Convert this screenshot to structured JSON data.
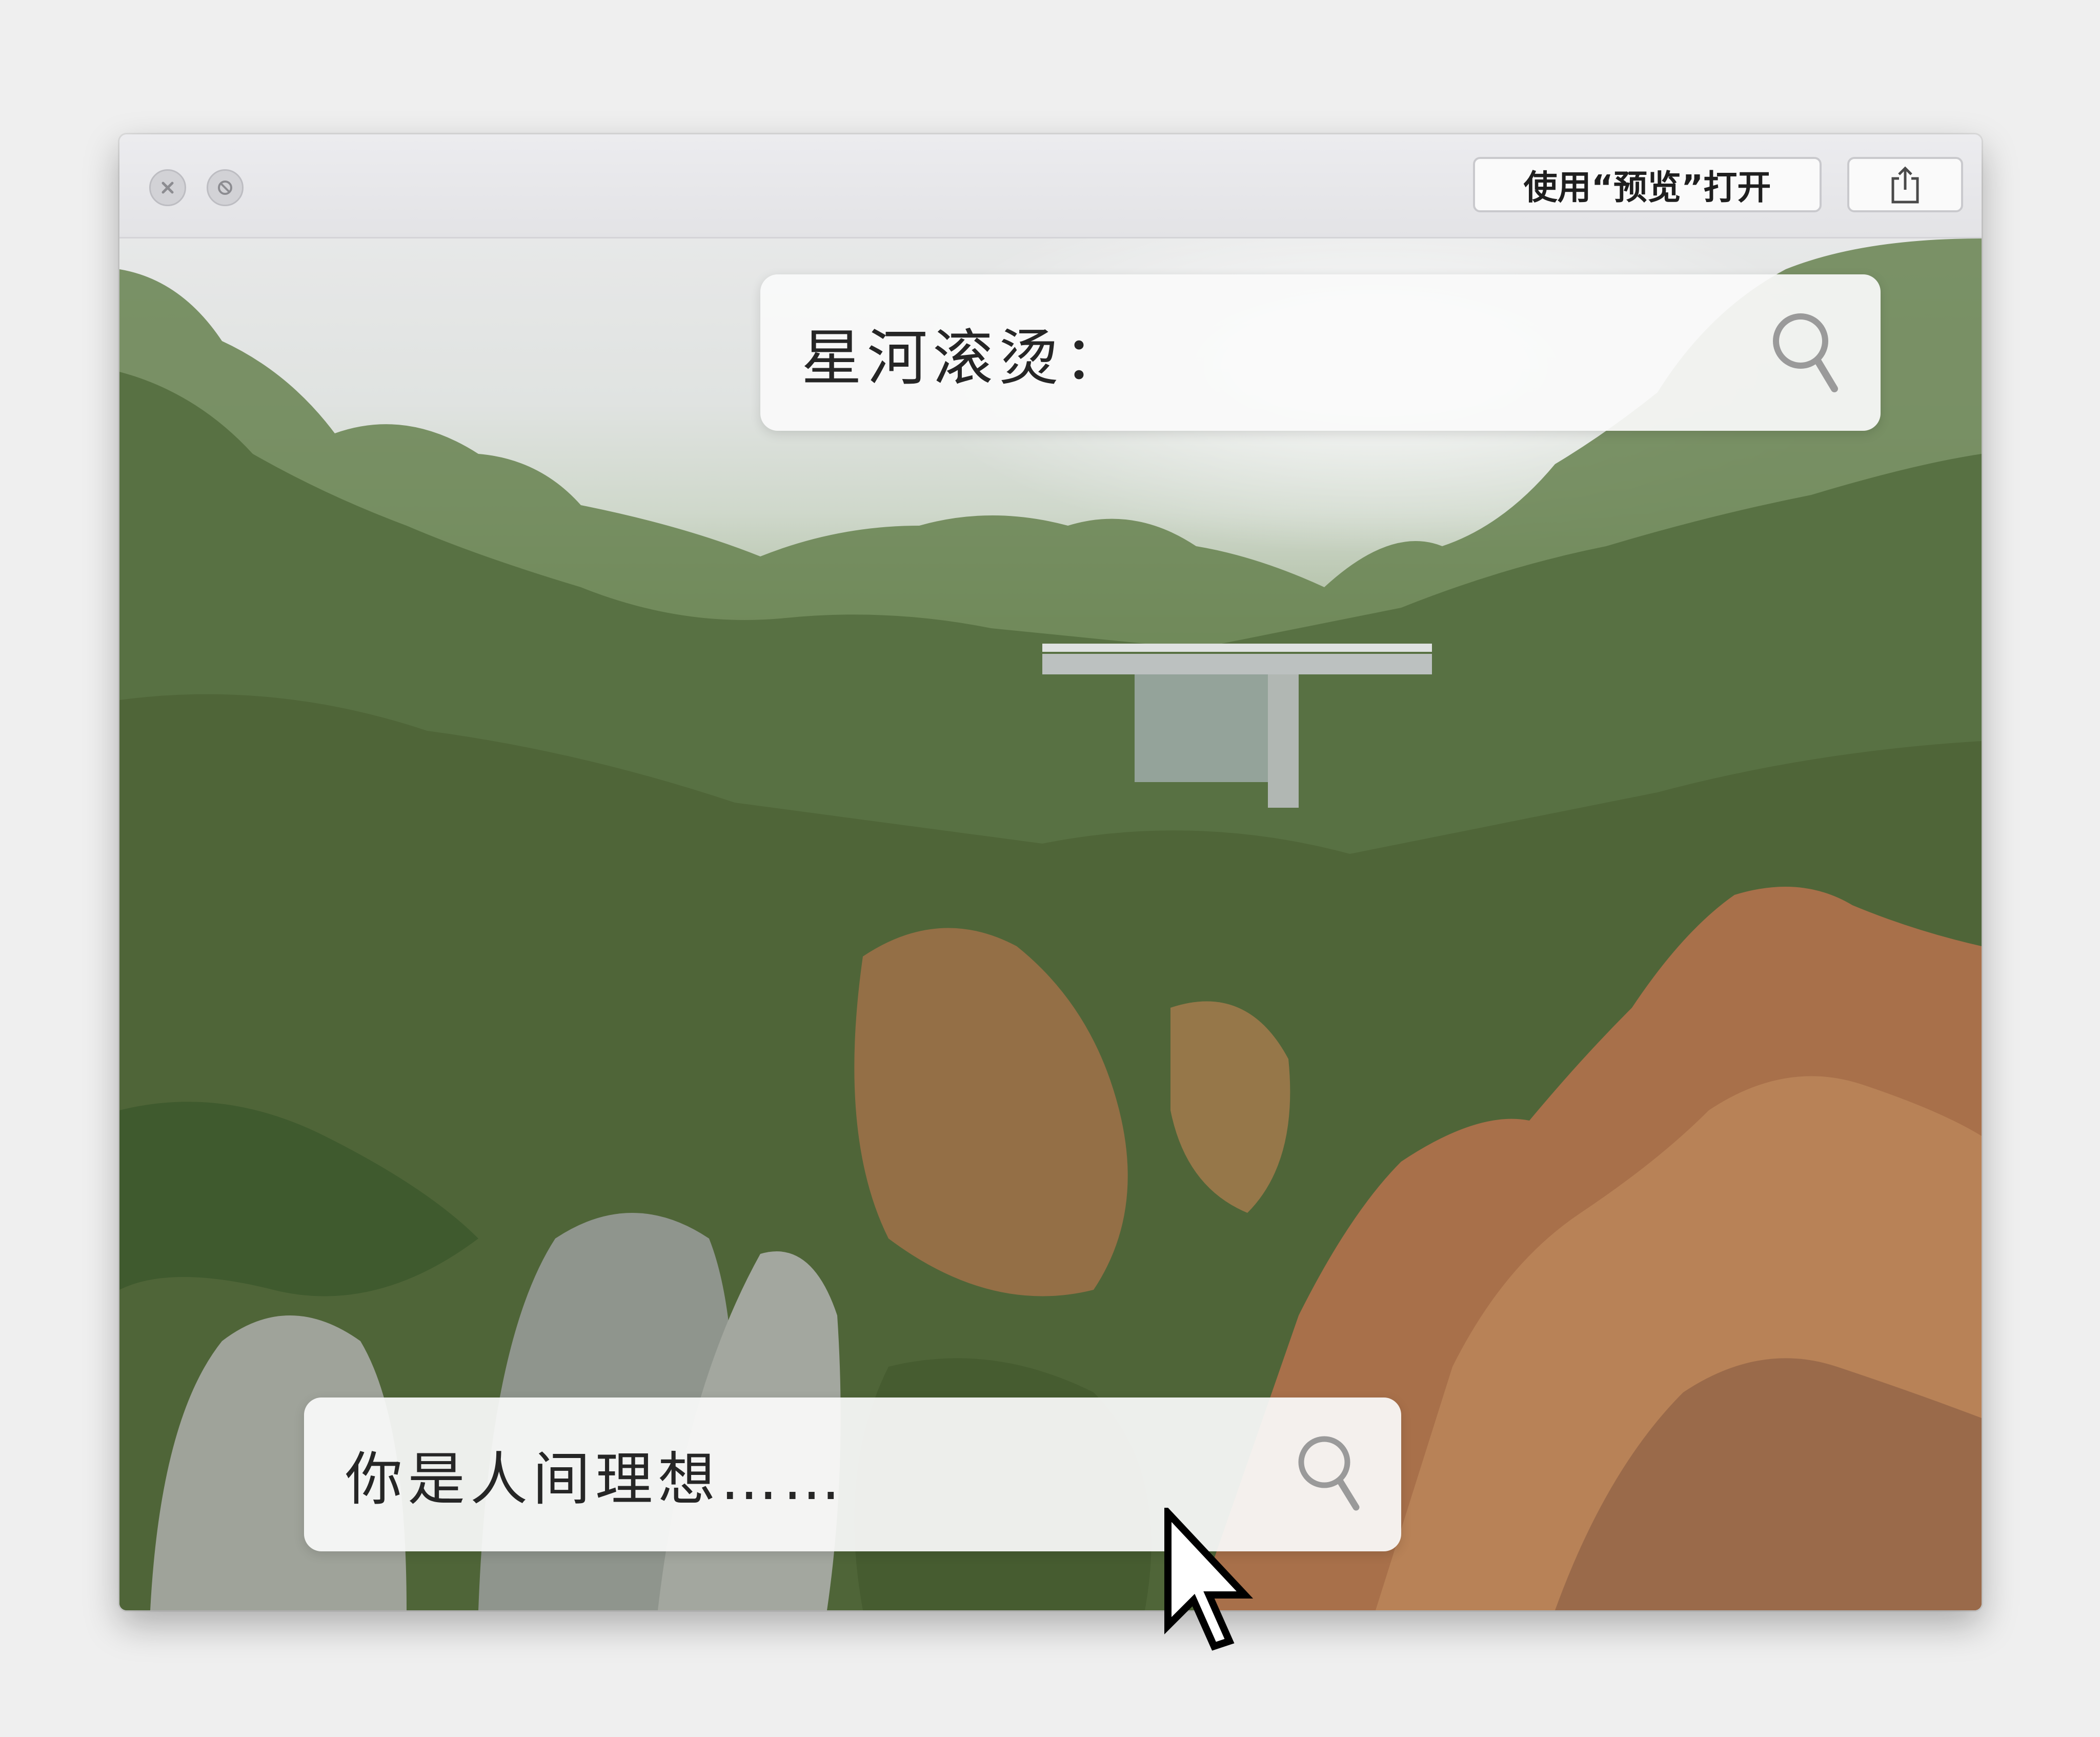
{
  "window": {
    "buttons": {
      "close": "close-icon",
      "minimize": "minimize-icon"
    },
    "toolbar": {
      "open_preview_label": "使用“预览”打开",
      "share_icon": "share-icon"
    }
  },
  "content": {
    "search_top": {
      "text": "星河滚烫：",
      "icon": "search-icon"
    },
    "search_bottom": {
      "text": "你是人间理想……",
      "icon": "search-icon"
    }
  },
  "colors": {
    "titlebar": "#e6e6e9",
    "panel": "#fafafa",
    "sky": "#e7e8e8",
    "foliage": "#5d7246",
    "rock": "#a8704a"
  }
}
